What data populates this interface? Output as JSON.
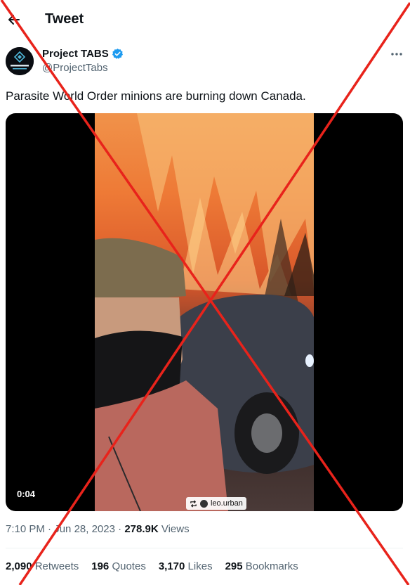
{
  "header": {
    "title": "Tweet"
  },
  "author": {
    "name": "Project TABS",
    "handle": "@ProjectTabs",
    "verified": true,
    "avatar_text": "PROJECT TABS"
  },
  "tweet": {
    "text": "Parasite World Order minions are burning down Canada.",
    "video_time": "0:04",
    "watermark_user": "leo.urban",
    "time": "7:10 PM",
    "date": "Jun 28, 2023",
    "views_count": "278.9K",
    "views_label": "Views"
  },
  "stats": {
    "retweets": {
      "count": "2,090",
      "label": "Retweets"
    },
    "quotes": {
      "count": "196",
      "label": "Quotes"
    },
    "likes": {
      "count": "3,170",
      "label": "Likes"
    },
    "bookmarks": {
      "count": "295",
      "label": "Bookmarks"
    }
  },
  "colors": {
    "verified_badge": "#1d9bf0",
    "secondary_text": "#536471",
    "overlay_cross": "#e8231b"
  }
}
